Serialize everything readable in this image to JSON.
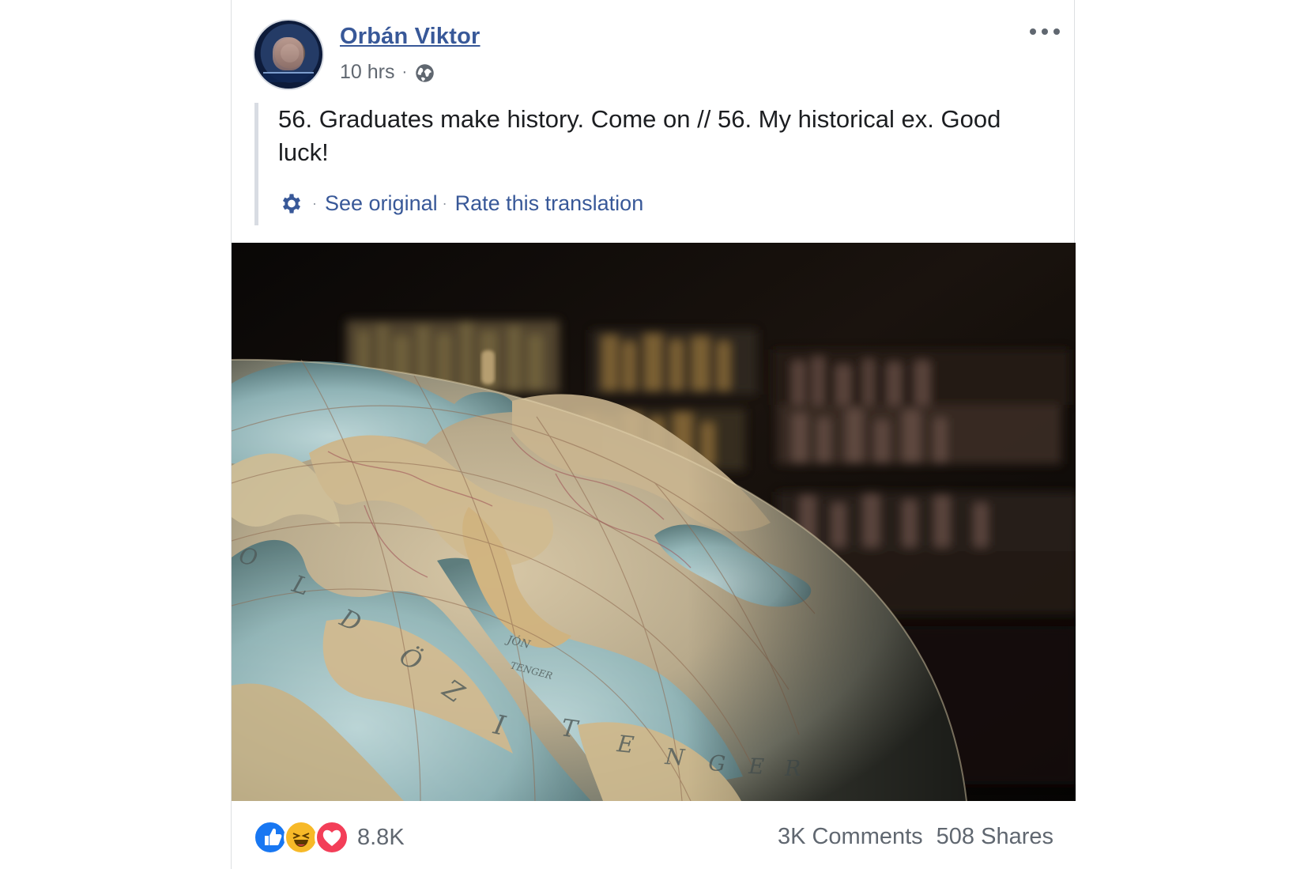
{
  "post": {
    "author": "Orbán Viktor",
    "time": "10 hrs",
    "separator": "·",
    "privacy_icon": "globe-icon",
    "more_icon": "more-options-icon",
    "translated_text": "56. Graduates make history. Come on // 56. My historical ex. Good luck!",
    "translation_actions": {
      "settings_icon": "gear-icon",
      "see_original": "See original",
      "rate_translation": "Rate this translation",
      "separator": "·"
    },
    "image": {
      "subject": "antique globe with books in background"
    },
    "reactions": {
      "icons": [
        "like-icon",
        "haha-icon",
        "love-icon"
      ],
      "count": "8.8K"
    },
    "stats": {
      "comments": "3K Comments",
      "shares": "508 Shares"
    }
  },
  "colors": {
    "link": "#385898",
    "meta": "#606770",
    "text": "#1c1e21",
    "like": "#1877f2",
    "haha": "#f7b928",
    "love": "#f33e58"
  }
}
